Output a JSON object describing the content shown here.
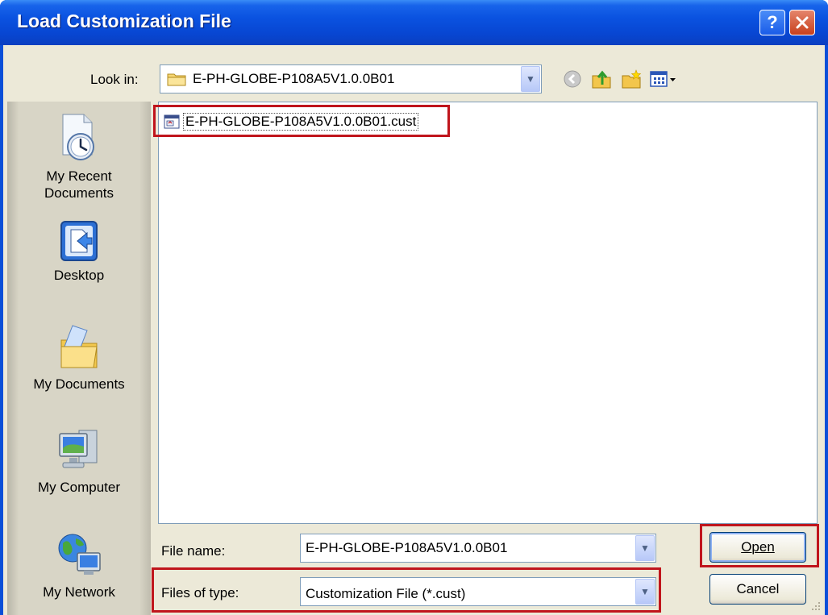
{
  "window": {
    "title": "Load Customization File"
  },
  "toolbar": {
    "look_in_label": "Look in:",
    "look_in_value": "E-PH-GLOBE-P108A5V1.0.0B01"
  },
  "places": [
    {
      "label_line1": "My Recent",
      "label_line2": "Documents",
      "icon": "recent-documents-icon"
    },
    {
      "label_line1": "Desktop",
      "label_line2": "",
      "icon": "desktop-icon"
    },
    {
      "label_line1": "My Documents",
      "label_line2": "",
      "icon": "my-documents-icon"
    },
    {
      "label_line1": "My Computer",
      "label_line2": "",
      "icon": "my-computer-icon"
    },
    {
      "label_line1": "My Network",
      "label_line2": "",
      "icon": "my-network-icon"
    }
  ],
  "files": [
    {
      "name": "E-PH-GLOBE-P108A5V1.0.0B01.cust",
      "icon": "cust-file-icon"
    }
  ],
  "form": {
    "file_name_label": "File name:",
    "file_name_value": "E-PH-GLOBE-P108A5V1.0.0B01",
    "file_type_label": "Files of type:",
    "file_type_value": "Customization File (*.cust)"
  },
  "buttons": {
    "open": "Open",
    "cancel": "Cancel"
  },
  "colors": {
    "highlight": "#c0151c",
    "titlebar": "#0a52e0",
    "dialog_bg": "#ece9d8"
  }
}
